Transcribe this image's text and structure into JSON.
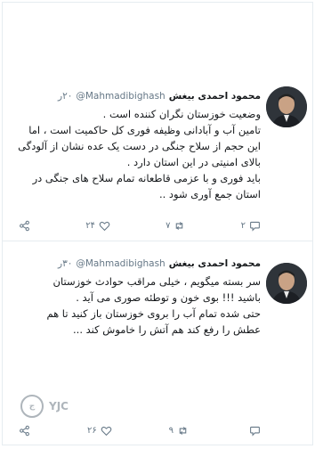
{
  "tweets": [
    {
      "name": "محمود احمدی بیغش",
      "handle": "@Mahmadibighash",
      "time": "۲۰ر",
      "lines": [
        "وضعیت خوزستان نگران کننده است .",
        "تامین آب و آبادانی وظیفه فوری کل حاکمیت است ، اما",
        "این حجم از سلاح جنگی در دست یک عده نشان از آلودگی",
        "بالای امنیتی در این استان دارد .",
        "باید فوری و با عزمی قاطعانه تمام سلاح های جنگی در",
        "استان جمع آوری شود .."
      ],
      "reply_count": "۲",
      "retweet_count": "۷",
      "like_count": "۲۴"
    },
    {
      "name": "محمود احمدی بیغش",
      "handle": "@Mahmadibighash",
      "time": "۳۰ر",
      "lines": [
        "سر بسته میگویم ، خیلی مراقب حوادث خوزستان",
        "باشید !!! بوی خون و توطئه صوری می آید .",
        "حتی شده تمام آب را بروی خوزستان باز کنید تا هم",
        "عطش را رفع کند هم آتش را خاموش کند ..."
      ],
      "reply_count": "",
      "retweet_count": "۹",
      "like_count": "۲۶"
    }
  ],
  "watermark": {
    "text": "YJC",
    "logo": "ج"
  },
  "colors": {
    "text": "#14171a",
    "muted": "#657786",
    "divider": "#e6ecf0"
  },
  "icons": [
    "share-icon",
    "like-icon",
    "retweet-icon",
    "reply-icon"
  ]
}
